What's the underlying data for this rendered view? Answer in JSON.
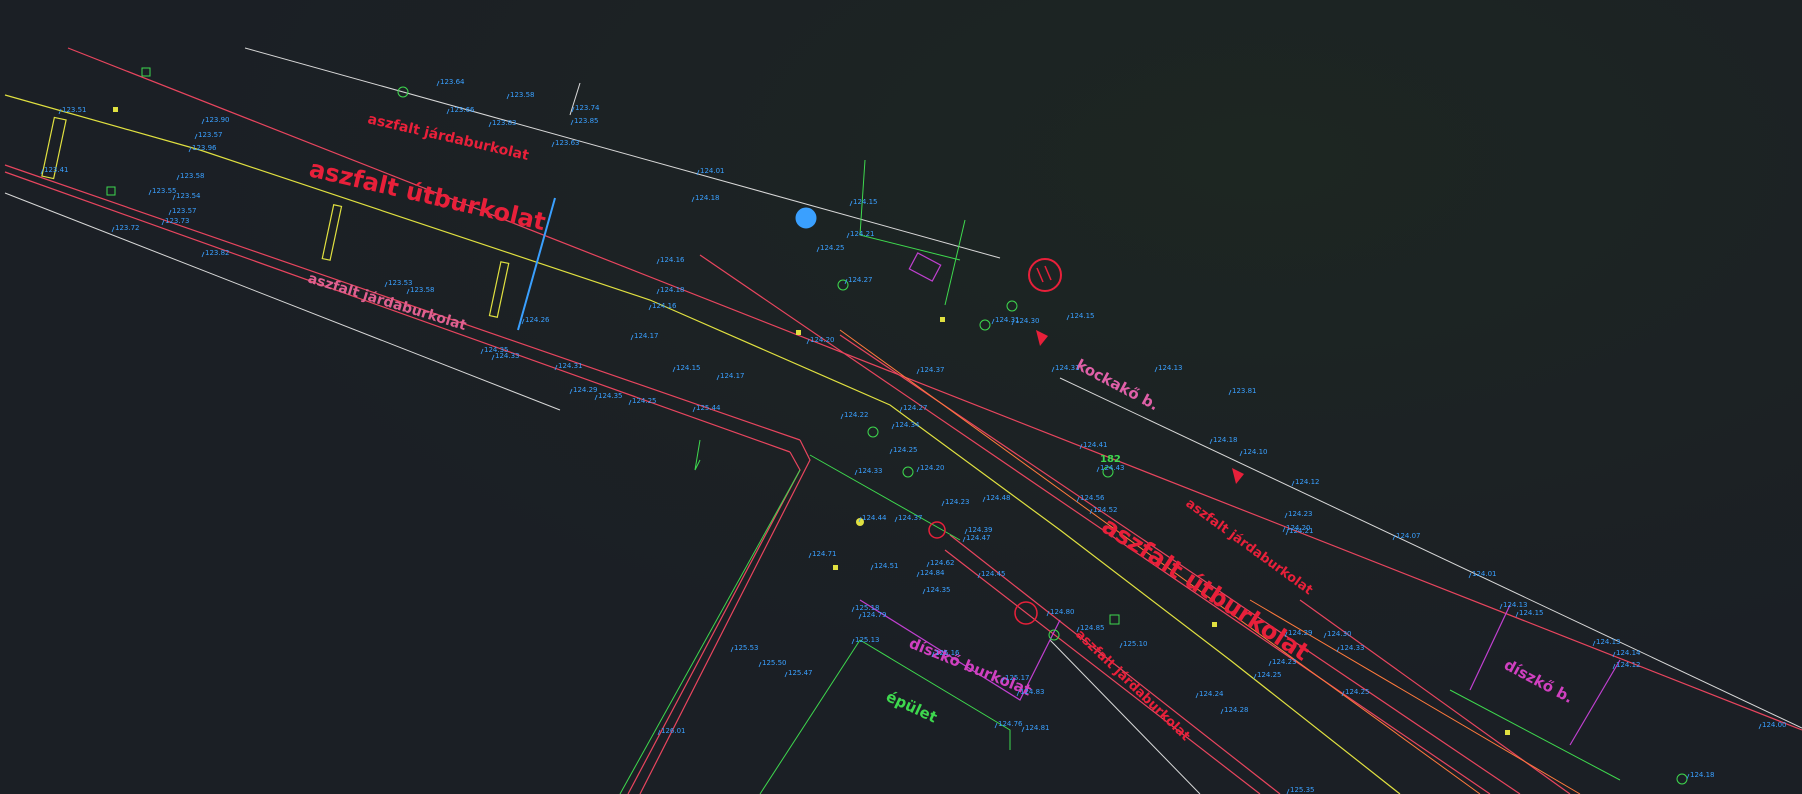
{
  "colors": {
    "background": "#1b1f25",
    "property_line": "#e8455e",
    "road_edge": "#e0e040",
    "curb": "#ff7a3c",
    "green": "#3ed84e",
    "magenta": "#c040d0",
    "white": "#d8d8d8",
    "cyan": "#3aa0ff",
    "label_red": "#e8203a",
    "label_pink": "#e06090",
    "label_green": "#3ed84e"
  },
  "labels": {
    "road_main_1": "aszfalt útburkolat",
    "road_main_2": "aszfalt útburkolat",
    "sidewalk_1": "aszfalt járdaburkolat",
    "sidewalk_2": "aszfalt járdaburkolat",
    "sidewalk_3": "aszfalt járdaburkolat",
    "sidewalk_4": "aszfalt járdaburkolat",
    "kockako": "kockakő b.",
    "diszko_burkolat": "díszkő burkolat",
    "diszko_b": "díszkő b.",
    "epulet": "épület",
    "tree_tag": "182"
  },
  "spot_heights": [
    "123.51",
    "123.41",
    "123.57",
    "123.58",
    "123.55",
    "123.90",
    "123.96",
    "123.54",
    "123.57",
    "123.72",
    "123.73",
    "123.82",
    "123.53",
    "123.58",
    "123.66",
    "123.64",
    "123.58",
    "123.83",
    "123.74",
    "123.85",
    "123.63",
    "124.01",
    "124.18",
    "124.16",
    "124.15",
    "124.21",
    "124.25",
    "124.27",
    "124.18",
    "124.16",
    "124.17",
    "124.15",
    "124.29",
    "124.25",
    "124.33",
    "124.35",
    "124.31",
    "124.35",
    "124.37",
    "124.27",
    "124.34",
    "124.25",
    "124.20",
    "124.23",
    "124.44",
    "124.51",
    "124.71",
    "124.79",
    "124.84",
    "125.18",
    "125.13",
    "125.16",
    "125.17",
    "125.47",
    "125.50",
    "125.53",
    "126.01",
    "124.26",
    "124.31",
    "124.30",
    "124.15",
    "124.13",
    "124.31",
    "123.81",
    "124.18",
    "124.10",
    "124.12",
    "124.23",
    "124.20",
    "124.21",
    "124.07",
    "124.01",
    "124.13",
    "124.15",
    "124.13",
    "124.14",
    "124.12",
    "124.00",
    "124.18",
    "124.29",
    "124.30",
    "124.33",
    "124.23",
    "124.25",
    "124.24",
    "124.28",
    "124.81",
    "124.76",
    "124.83",
    "124.80",
    "124.85",
    "125.10",
    "124.47",
    "124.48",
    "124.43",
    "124.41",
    "124.56",
    "124.52",
    "124.62",
    "124.35",
    "124.22",
    "124.33",
    "124.37",
    "124.39",
    "124.45",
    "125.35",
    "124.25",
    "124.17",
    "124.20",
    "125.44"
  ]
}
